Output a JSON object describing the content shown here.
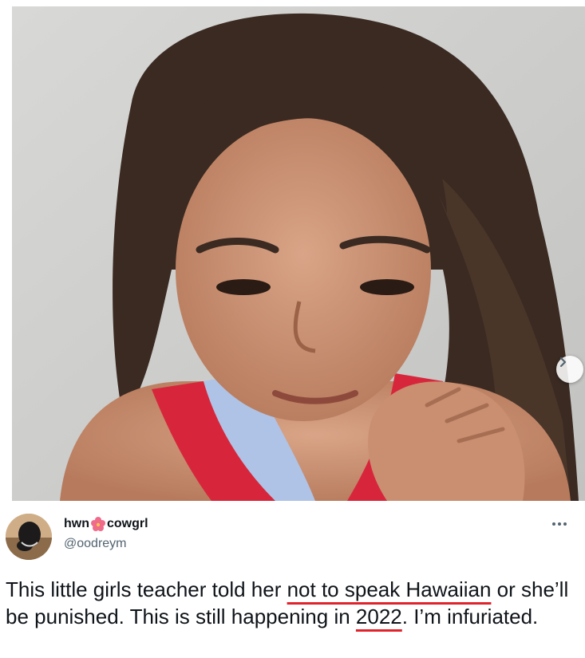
{
  "tweet": {
    "author": {
      "name_part_1": "hwn",
      "name_emoji": "hibiscus-icon",
      "name_part_2": "cowgrl",
      "handle": "@oodreym"
    },
    "more_label": "···",
    "media": {
      "description_icon": "photo",
      "next_button": "chevron-right-icon"
    },
    "text": {
      "part1": "This little girls teacher told her ",
      "underline1": "not to speak Hawaiian",
      "part2": " or she’ll be punished. This is still happening in ",
      "underline2": "2022",
      "part3": ". I’m infuriated."
    }
  },
  "colors": {
    "underline": "#e0222a",
    "text": "#0f1419",
    "secondary": "#536471"
  }
}
